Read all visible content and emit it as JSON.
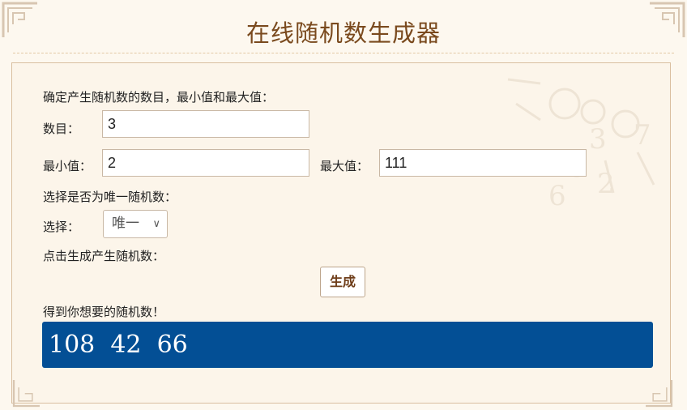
{
  "page_title": "在线随机数生成器",
  "form": {
    "intro": "确定产生随机数的数目，最小值和最大值：",
    "count_label": "数目：",
    "count_value": "3",
    "min_label": "最小值：",
    "min_value": "2",
    "max_label": "最大值：",
    "max_value": "111",
    "unique_prompt": "选择是否为唯一随机数：",
    "select_label": "选择：",
    "select_value": "唯一",
    "generate_prompt": "点击生成产生随机数：",
    "generate_button": "生成",
    "result_prompt": "得到你想要的随机数！",
    "result_value": "108  42  66"
  },
  "colors": {
    "title": "#7a4a1e",
    "result_bg": "#034f95",
    "button_text": "#6e3d19"
  }
}
